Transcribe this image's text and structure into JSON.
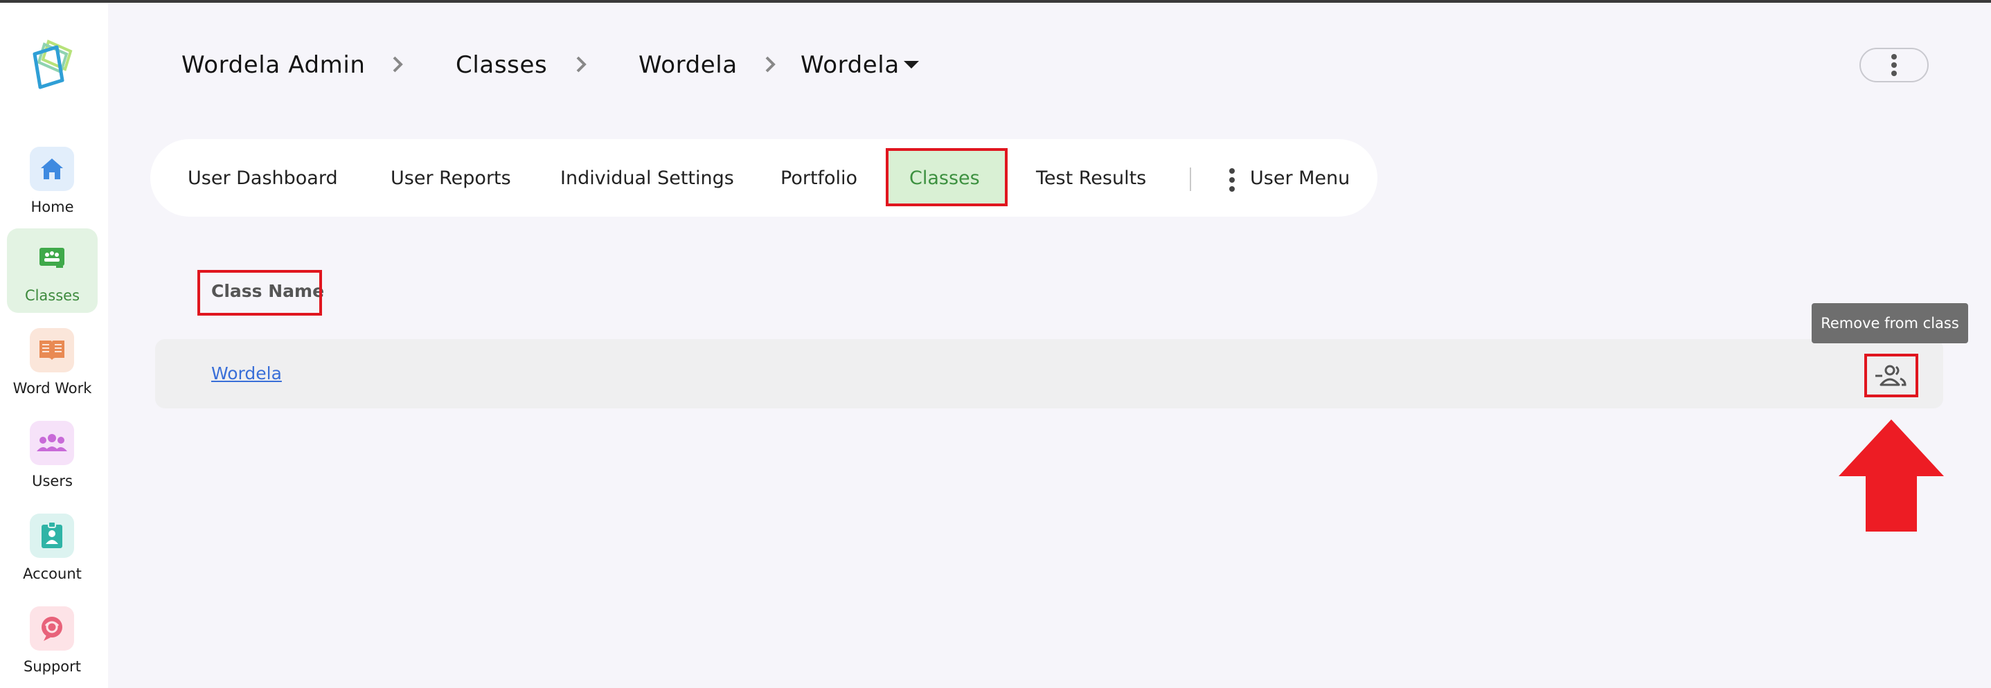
{
  "breadcrumb": {
    "items": [
      "Wordela Admin",
      "Classes",
      "Wordela",
      "Wordela"
    ]
  },
  "sidebar": {
    "items": [
      {
        "label": "Home",
        "icon": "home-icon",
        "color": "#3f8ae0"
      },
      {
        "label": "Classes",
        "icon": "classroom-icon",
        "color": "#3fa94a"
      },
      {
        "label": "Word Work",
        "icon": "book-icon",
        "color": "#e98a53"
      },
      {
        "label": "Users",
        "icon": "users-icon",
        "color": "#c86ad8"
      },
      {
        "label": "Account",
        "icon": "account-badge-icon",
        "color": "#2fb4a6"
      },
      {
        "label": "Support",
        "icon": "support-icon",
        "color": "#e8627a"
      }
    ],
    "active": "Classes"
  },
  "tabs": {
    "items": [
      "User Dashboard",
      "User Reports",
      "Individual Settings",
      "Portfolio",
      "Classes",
      "Test Results"
    ],
    "active": "Classes",
    "menu_label": "User Menu"
  },
  "table": {
    "header": "Class Name",
    "rows": [
      {
        "class_name": "Wordela"
      }
    ]
  },
  "tooltip": {
    "text": "Remove from class"
  },
  "colors": {
    "highlight": "#e0161f",
    "active_tab_bg": "#d9f0d4",
    "link": "#3a6fd8"
  }
}
